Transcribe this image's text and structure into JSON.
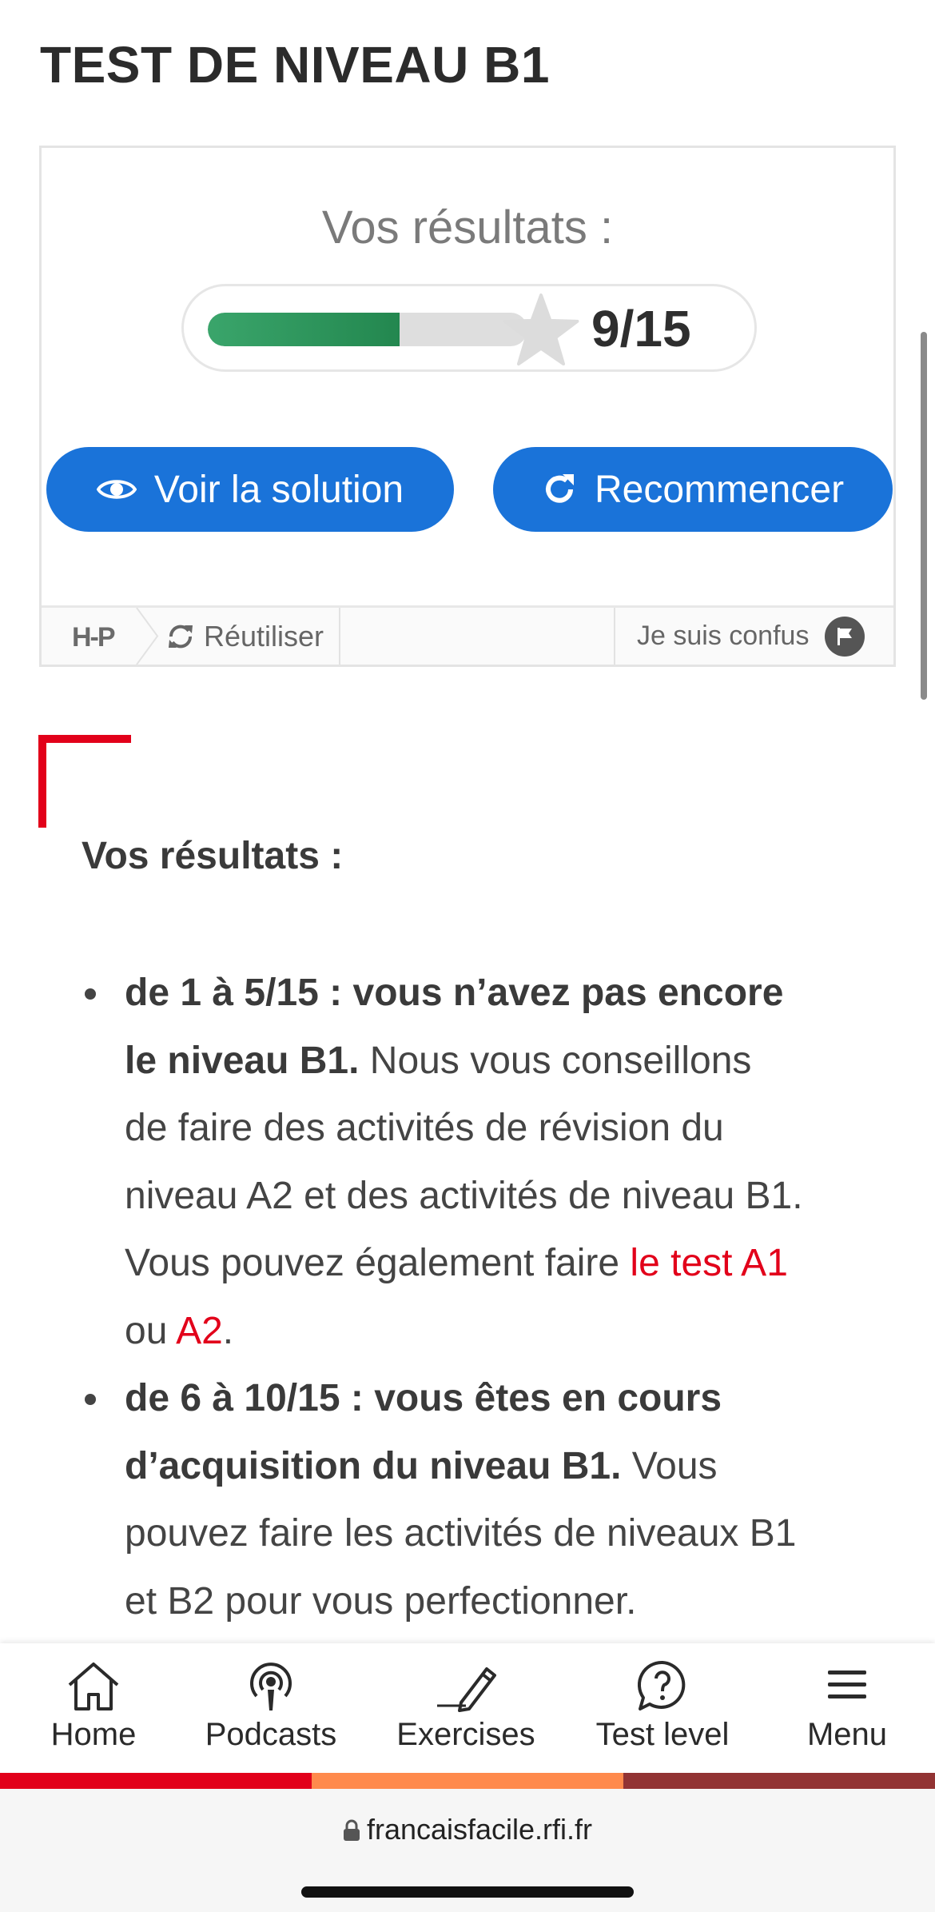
{
  "page": {
    "title": "TEST DE NIVEAU B1"
  },
  "quiz": {
    "results_heading": "Vos résultats :",
    "score_text": "9/15",
    "progress_fraction": 0.6,
    "solution_button": "Voir la solution",
    "restart_button": "Recommencer",
    "footer": {
      "logo": "H-P",
      "reuse_label": "Réutiliser",
      "confused_label": "Je suis confus"
    }
  },
  "results_info": {
    "heading": "Vos résultats :",
    "items": [
      {
        "bold": "de 1 à 5/15 : vous n’avez pas encore le niveau B1.",
        "text": " Nous vous conseillons de faire des activités de révision du niveau A2 et des activités de niveau B1. Vous pouvez également faire ",
        "link1": "le test A1",
        "mid": " ou ",
        "link2": "A2",
        "end": "."
      },
      {
        "bold": "de 6 à 10/15 : vous êtes en cours d’acquisition du niveau B1.",
        "text": " Vous pouvez faire les activités de niveaux B1 et B2 pour vous perfectionner."
      }
    ]
  },
  "bottom_nav": {
    "items": [
      {
        "label": "Home",
        "icon": "home-icon"
      },
      {
        "label": "Podcasts",
        "icon": "podcast-icon"
      },
      {
        "label": "Exercises",
        "icon": "pencil-icon"
      },
      {
        "label": "Test level",
        "icon": "question-bubble-icon"
      },
      {
        "label": "Menu",
        "icon": "hamburger-icon"
      }
    ],
    "stripe_colors": [
      "#e2001a",
      "#ff8a4c",
      "#923333"
    ]
  },
  "browser": {
    "url": "francaisfacile.rfi.fr"
  },
  "colors": {
    "accent_blue": "#1a73d9",
    "brand_red": "#e2001a",
    "progress_green": "#2e9a5e"
  }
}
